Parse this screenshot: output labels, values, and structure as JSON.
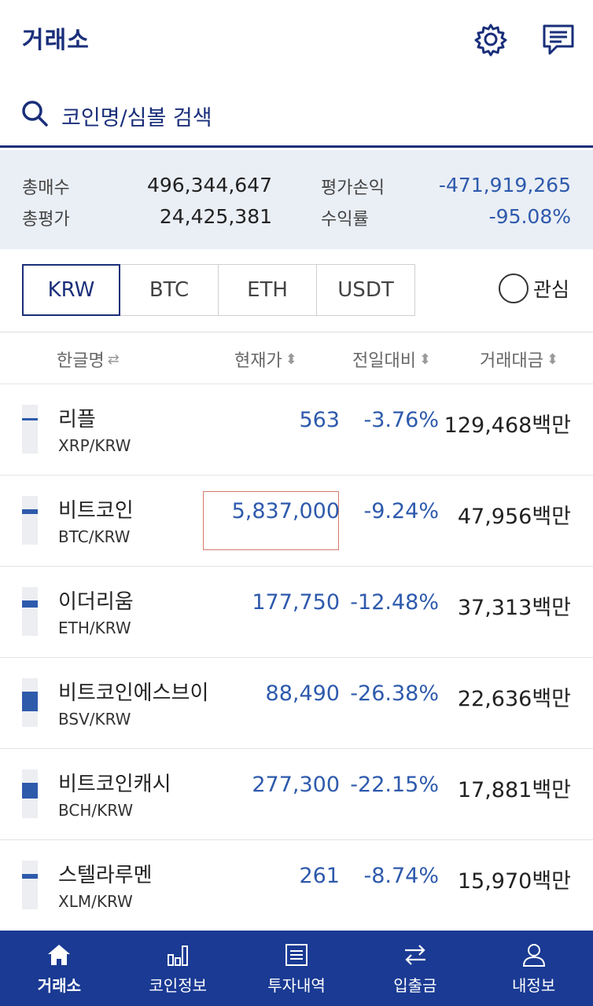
{
  "header": {
    "title": "거래소",
    "settings_icon": "gear-icon",
    "message_icon": "chat-icon"
  },
  "search": {
    "placeholder": "코인명/심볼 검색",
    "icon": "search-icon"
  },
  "summary": {
    "total_buy_label": "총매수",
    "total_buy_value": "496,344,647",
    "total_eval_label": "총평가",
    "total_eval_value": "24,425,381",
    "pnl_label": "평가손익",
    "pnl_value": "-471,919,265",
    "return_label": "수익률",
    "return_value": "-95.08%"
  },
  "market_tabs": {
    "krw": "KRW",
    "btc": "BTC",
    "eth": "ETH",
    "usdt": "USDT",
    "active": "KRW"
  },
  "favorites": {
    "label": "관심"
  },
  "columns": {
    "name": "한글명",
    "price": "현재가",
    "change": "전일대비",
    "volume": "거래대금"
  },
  "coins": [
    {
      "name": "리플",
      "pair": "XRP/KRW",
      "price": "563",
      "change": "-3.76%",
      "volume": "129,468백만",
      "bar_level": 0.04
    },
    {
      "name": "비트코인",
      "pair": "BTC/KRW",
      "price": "5,837,000",
      "change": "-9.24%",
      "volume": "47,956백만",
      "bar_level": 0.1
    },
    {
      "name": "이더리움",
      "pair": "ETH/KRW",
      "price": "177,750",
      "change": "-12.48%",
      "volume": "37,313백만",
      "bar_level": 0.14
    },
    {
      "name": "비트코인에스브이",
      "pair": "BSV/KRW",
      "price": "88,490",
      "change": "-26.38%",
      "volume": "22,636백만",
      "bar_level": 0.4
    },
    {
      "name": "비트코인캐시",
      "pair": "BCH/KRW",
      "price": "277,300",
      "change": "-22.15%",
      "volume": "17,881백만",
      "bar_level": 0.32
    },
    {
      "name": "스텔라루멘",
      "pair": "XLM/KRW",
      "price": "261",
      "change": "-8.74%",
      "volume": "15,970백만",
      "bar_level": 0.1
    }
  ],
  "bottom_nav": {
    "exchange": "거래소",
    "coin_info": "코인정보",
    "history": "투자내역",
    "deposit": "입출금",
    "my_info": "내정보"
  },
  "colors": {
    "brand": "#1a2f7a",
    "nav_bg": "#1a3a93",
    "fall": "#2e5aac",
    "summary_bg": "#eaeef5"
  }
}
